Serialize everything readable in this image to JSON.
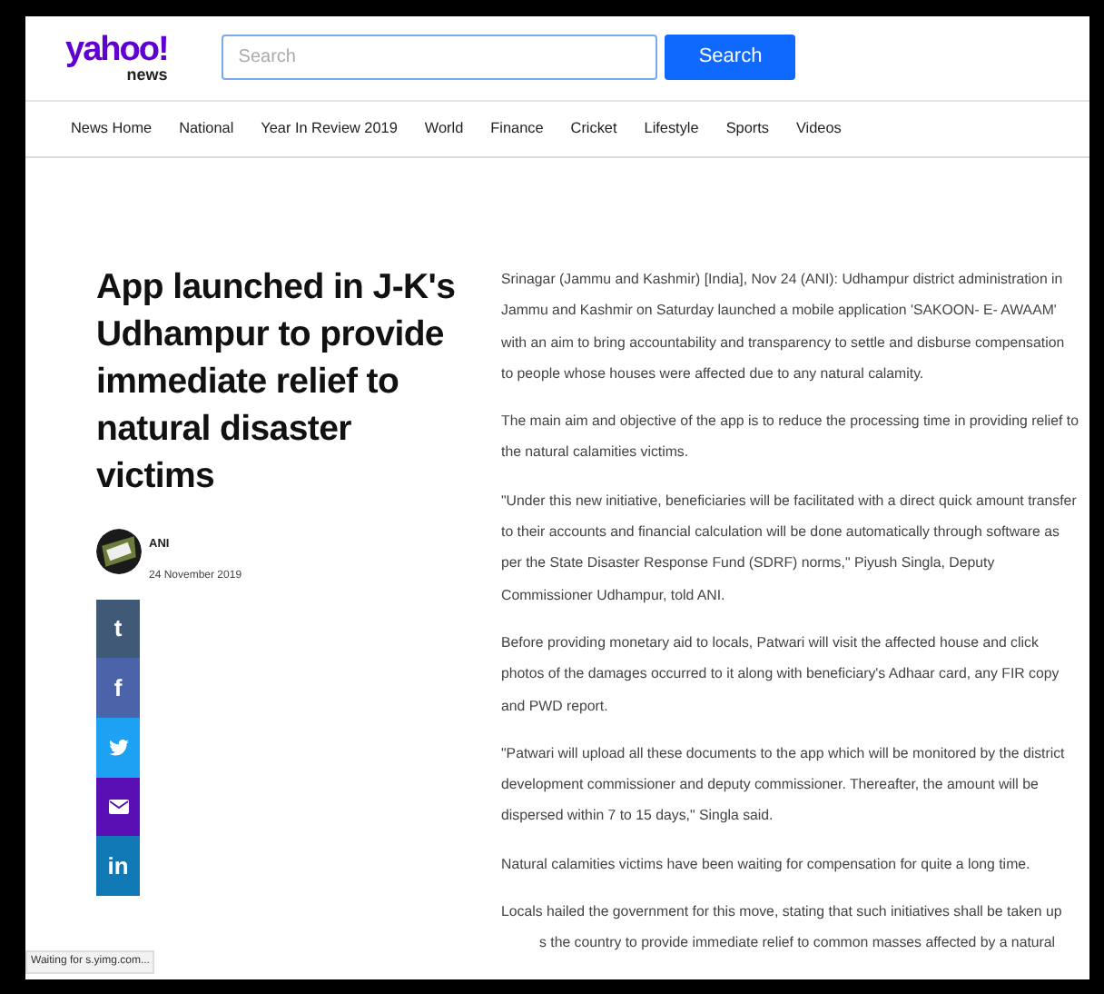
{
  "logo": {
    "brand": "yahoo!",
    "section": "news"
  },
  "search": {
    "placeholder": "Search",
    "button": "Search"
  },
  "nav": [
    "News Home",
    "National",
    "Year In Review 2019",
    "World",
    "Finance",
    "Cricket",
    "Lifestyle",
    "Sports",
    "Videos"
  ],
  "article": {
    "title": "App launched in J-K's Udhampur to provide immediate relief to natural disaster victims",
    "author": {
      "name": "ANI",
      "date": "24 November 2019"
    },
    "share": [
      {
        "kind": "glyph",
        "glyph": "t",
        "color": "#3f5976"
      },
      {
        "kind": "glyph",
        "glyph": "f",
        "color": "#4b63a8"
      },
      {
        "kind": "bird",
        "color": "#1da1f2"
      },
      {
        "kind": "mail",
        "color": "#5a0fb4"
      },
      {
        "kind": "glyph",
        "glyph": "in",
        "color": "#0f78b5"
      }
    ],
    "paragraphs": [
      {
        "lines": [
          "Srinagar (Jammu and Kashmir) [India], Nov 24 (ANI): Udhampur district administration in Jammu and Kashmir on Saturday launched a mobile application 'SAKOON- E- AWAAM' with an aim to bring accountability and transparency to settle and disburse compensation to people whose houses were affected due to any natural calamity."
        ]
      },
      {
        "lines": [
          "The main aim and objective of the app is to reduce the processing time in providing relief to the natural calamities victims."
        ]
      },
      {
        "lines": [
          "\"Under this new initiative, beneficiaries will be facilitated with a direct quick amount transfer to their accounts and financial calculation will be done automatically through software as per the State Disaster Response Fund (SDRF) norms,\" Piyush Singla, Deputy Commissioner Udhampur, told ANI."
        ]
      },
      {
        "lines": [
          "Before providing monetary aid to locals, Patwari will visit the affected house and click photos of the damages occurred to it along with beneficiary's Adhaar card, any FIR copy and PWD report."
        ]
      },
      {
        "lines": [
          "\"Patwari will upload all these documents to the app which will be monitored by the district development commissioner and deputy commissioner. Thereafter, the amount will be dispersed within 7 to 15 days,\" Singla said."
        ]
      },
      {
        "lines": [
          "Natural calamities victims have been waiting for compensation for quite a long time."
        ]
      },
      {
        "lines": [
          "Locals hailed the government for this move, stating that such initiatives shall be taken up",
          "s the country to provide immediate relief to common masses affected by a natural"
        ]
      }
    ]
  },
  "status_bar": "Waiting for s.yimg.com..."
}
